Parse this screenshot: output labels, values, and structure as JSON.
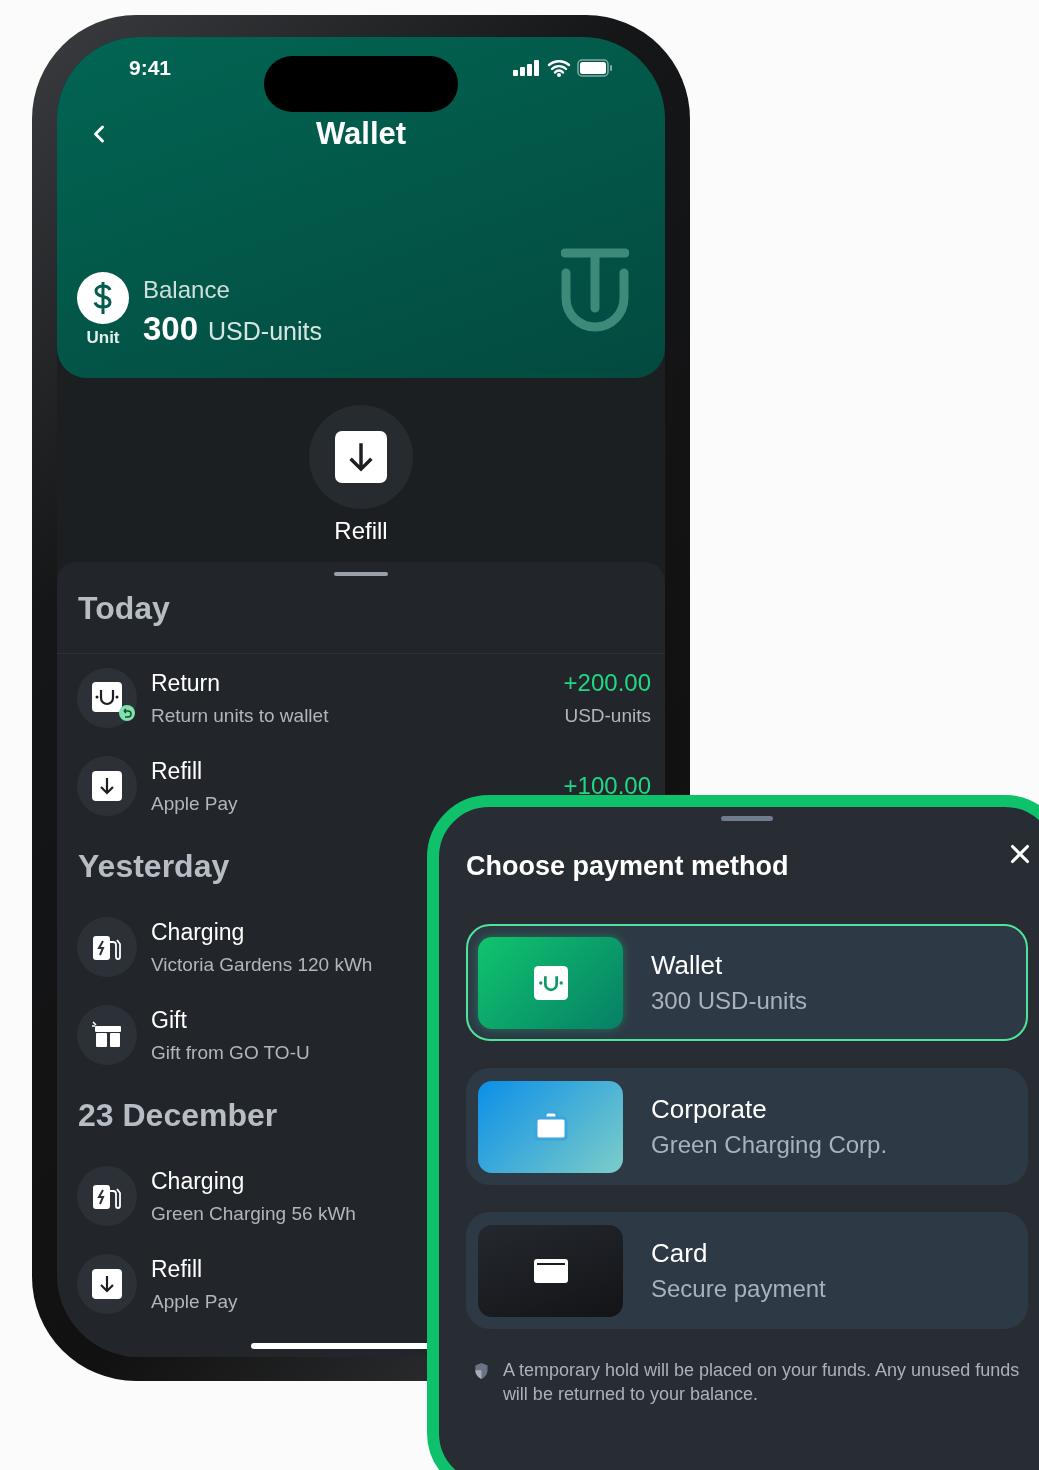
{
  "status_bar": {
    "time": "9:41"
  },
  "header": {
    "title": "Wallet",
    "currency_badge": "Unit",
    "balance_label": "Balance",
    "amount": "300",
    "unit": "USD-units"
  },
  "actions": [
    {
      "kind": "refill",
      "label": "Refill"
    }
  ],
  "history": [
    {
      "heading": "Today",
      "items": [
        {
          "kind": "return",
          "title": "Return",
          "subtitle": "Return units to wallet",
          "amount": "+200.00",
          "unit": "USD-units"
        },
        {
          "kind": "refill",
          "title": "Refill",
          "subtitle": "Apple Pay",
          "amount": "+100.00"
        }
      ]
    },
    {
      "heading": "Yesterday",
      "items": [
        {
          "kind": "charging",
          "title": "Charging",
          "subtitle": "Victoria Gardens 120 kWh"
        },
        {
          "kind": "gift",
          "title": "Gift",
          "subtitle": "Gift from GO TO-U"
        }
      ]
    },
    {
      "heading": "23 December",
      "items": [
        {
          "kind": "charging",
          "title": "Charging",
          "subtitle": "Green Charging 56 kWh"
        },
        {
          "kind": "refill",
          "title": "Refill",
          "subtitle": "Apple Pay"
        }
      ]
    }
  ],
  "payment_sheet": {
    "title": "Choose payment method",
    "options": [
      {
        "kind": "wallet",
        "title": "Wallet",
        "subtitle": "300 USD-units",
        "selected": true
      },
      {
        "kind": "corporate",
        "title": "Corporate",
        "subtitle": "Green Charging Corp.",
        "selected": false
      },
      {
        "kind": "card",
        "title": "Card",
        "subtitle": "Secure payment",
        "selected": false
      }
    ],
    "notice": "A temporary hold will be placed on your funds. Any unused funds will be returned to your balance."
  }
}
